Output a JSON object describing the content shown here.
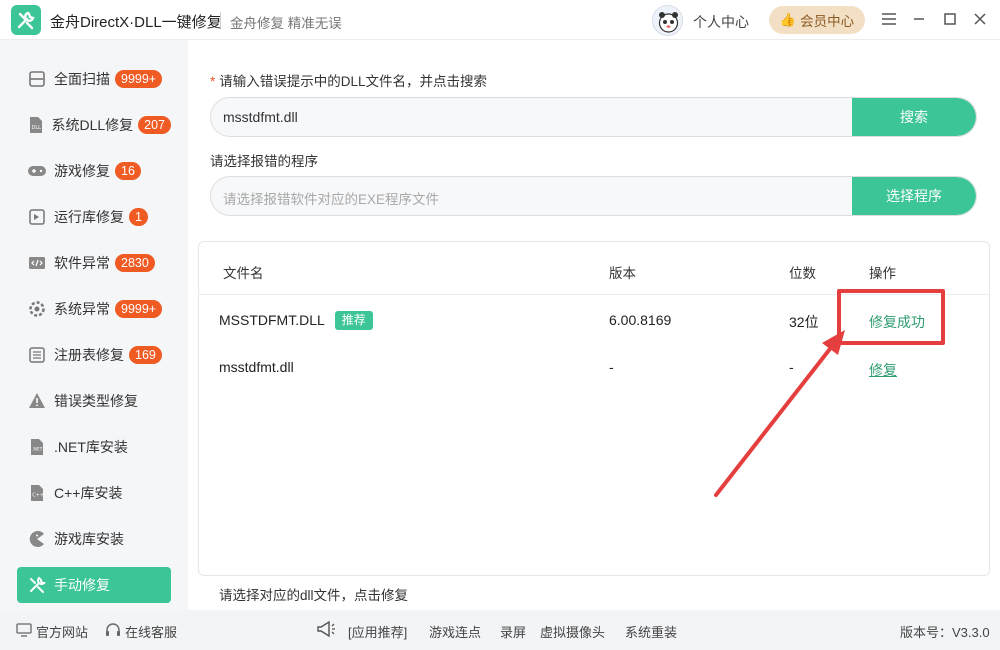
{
  "titlebar": {
    "app_title": "金舟DirectX·DLL一键修复",
    "subtitle": "金舟修复 精准无误",
    "personal_center": "个人中心",
    "vip_center": "会员中心"
  },
  "sidebar": {
    "items": [
      {
        "label": "全面扫描",
        "badge": "9999+",
        "icon": "scan-icon"
      },
      {
        "label": "系统DLL修复",
        "badge": "207",
        "icon": "dll-icon"
      },
      {
        "label": "游戏修复",
        "badge": "16",
        "icon": "gamepad-icon"
      },
      {
        "label": "运行库修复",
        "badge": "1",
        "icon": "visual-studio-icon"
      },
      {
        "label": "软件异常",
        "badge": "2830",
        "icon": "code-icon"
      },
      {
        "label": "系统异常",
        "badge": "9999+",
        "icon": "gear-icon"
      },
      {
        "label": "注册表修复",
        "badge": "169",
        "icon": "list-icon"
      },
      {
        "label": "错误类型修复",
        "badge": "",
        "icon": "warning-icon"
      },
      {
        "label": ".NET库安装",
        "badge": "",
        "icon": "dotnet-icon"
      },
      {
        "label": "C++库安装",
        "badge": "",
        "icon": "cpp-icon"
      },
      {
        "label": "游戏库安装",
        "badge": "",
        "icon": "pacman-icon"
      },
      {
        "label": "手动修复",
        "badge": "",
        "icon": "tools-icon"
      }
    ]
  },
  "form": {
    "dll_label": "请输入错误提示中的DLL文件名，并点击搜索",
    "required_mark": "*",
    "dll_value": "msstdfmt.dll",
    "search_button": "搜索",
    "program_label": "请选择报错的程序",
    "program_placeholder": "请选择报错软件对应的EXE程序文件",
    "select_program_button": "选择程序"
  },
  "table": {
    "headers": {
      "filename": "文件名",
      "version": "版本",
      "bits": "位数",
      "action": "操作"
    },
    "rows": [
      {
        "filename": "MSSTDFMT.DLL",
        "tag": "推荐",
        "version": "6.00.8169",
        "bits": "32位",
        "action": "修复成功"
      },
      {
        "filename": "msstdfmt.dll",
        "tag": "",
        "version": "-",
        "bits": "-",
        "action": "修复"
      }
    ]
  },
  "hint": "请选择对应的dll文件，点击修复",
  "footer": {
    "official_site": "官方网站",
    "online_service": "在线客服",
    "app_recommend": "[应用推荐]",
    "links": [
      "游戏连点",
      "录屏",
      "虚拟摄像头",
      "系统重装"
    ],
    "version": "版本号：V3.3.0"
  },
  "colors": {
    "accent": "#3cc596",
    "badge": "#f05a23",
    "highlight_box": "#e53e3e",
    "success_text": "#2e9e6f"
  }
}
